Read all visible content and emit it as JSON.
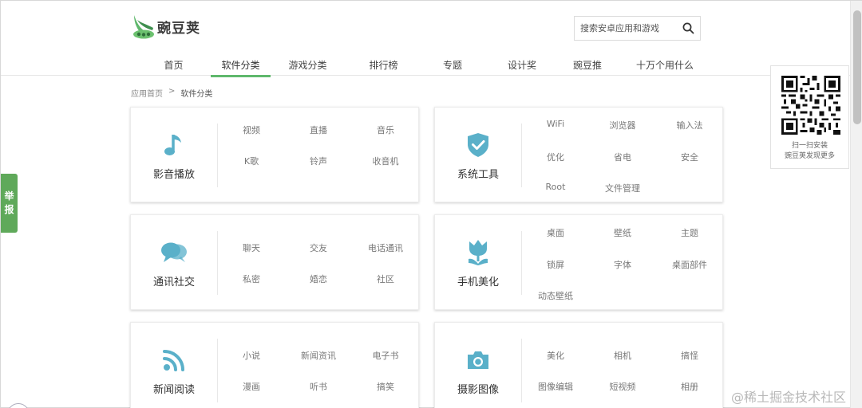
{
  "brand": {
    "name": "豌豆荚",
    "color": "#5fb86c"
  },
  "search": {
    "placeholder": "搜索安卓应用和游戏",
    "icon": "search-icon"
  },
  "nav": [
    {
      "label": "首页",
      "active": false
    },
    {
      "label": "软件分类",
      "active": true
    },
    {
      "label": "游戏分类",
      "active": false
    },
    {
      "label": "排行榜",
      "active": false
    },
    {
      "label": "专题",
      "active": false
    },
    {
      "label": "设计奖",
      "active": false
    },
    {
      "label": "豌豆推",
      "active": false
    },
    {
      "label": "十万个用什么",
      "active": false
    }
  ],
  "breadcrumb": {
    "home": "应用首页",
    "sep": ">",
    "current": "软件分类"
  },
  "categories": [
    {
      "name": "影音播放",
      "icon": "music-note-icon",
      "links": [
        "视频",
        "直播",
        "音乐",
        "K歌",
        "铃声",
        "收音机"
      ]
    },
    {
      "name": "系统工具",
      "icon": "shield-check-icon",
      "links": [
        "WiFi",
        "浏览器",
        "输入法",
        "优化",
        "省电",
        "安全",
        "Root",
        "文件管理"
      ]
    },
    {
      "name": "通讯社交",
      "icon": "chat-bubbles-icon",
      "links": [
        "聊天",
        "交友",
        "电话通讯",
        "私密",
        "婚恋",
        "社区"
      ]
    },
    {
      "name": "手机美化",
      "icon": "tulip-icon",
      "links": [
        "桌面",
        "壁纸",
        "主题",
        "锁屏",
        "字体",
        "桌面部件",
        "动态壁纸"
      ]
    },
    {
      "name": "新闻阅读",
      "icon": "rss-icon",
      "links": [
        "小说",
        "新闻资讯",
        "电子书",
        "漫画",
        "听书",
        "搞笑"
      ]
    },
    {
      "name": "摄影图像",
      "icon": "camera-icon",
      "links": [
        "美化",
        "相机",
        "搞怪",
        "图像编辑",
        "短视频",
        "相册"
      ]
    }
  ],
  "report": {
    "line1": "举",
    "line2": "报"
  },
  "qr": {
    "line1": "扫一扫安装",
    "line2": "豌豆荚发现更多"
  },
  "watermark": "@稀土掘金技术社区",
  "colors": {
    "icon": "#5ab0c9",
    "report": "#5fa95a",
    "link": "#777777"
  }
}
